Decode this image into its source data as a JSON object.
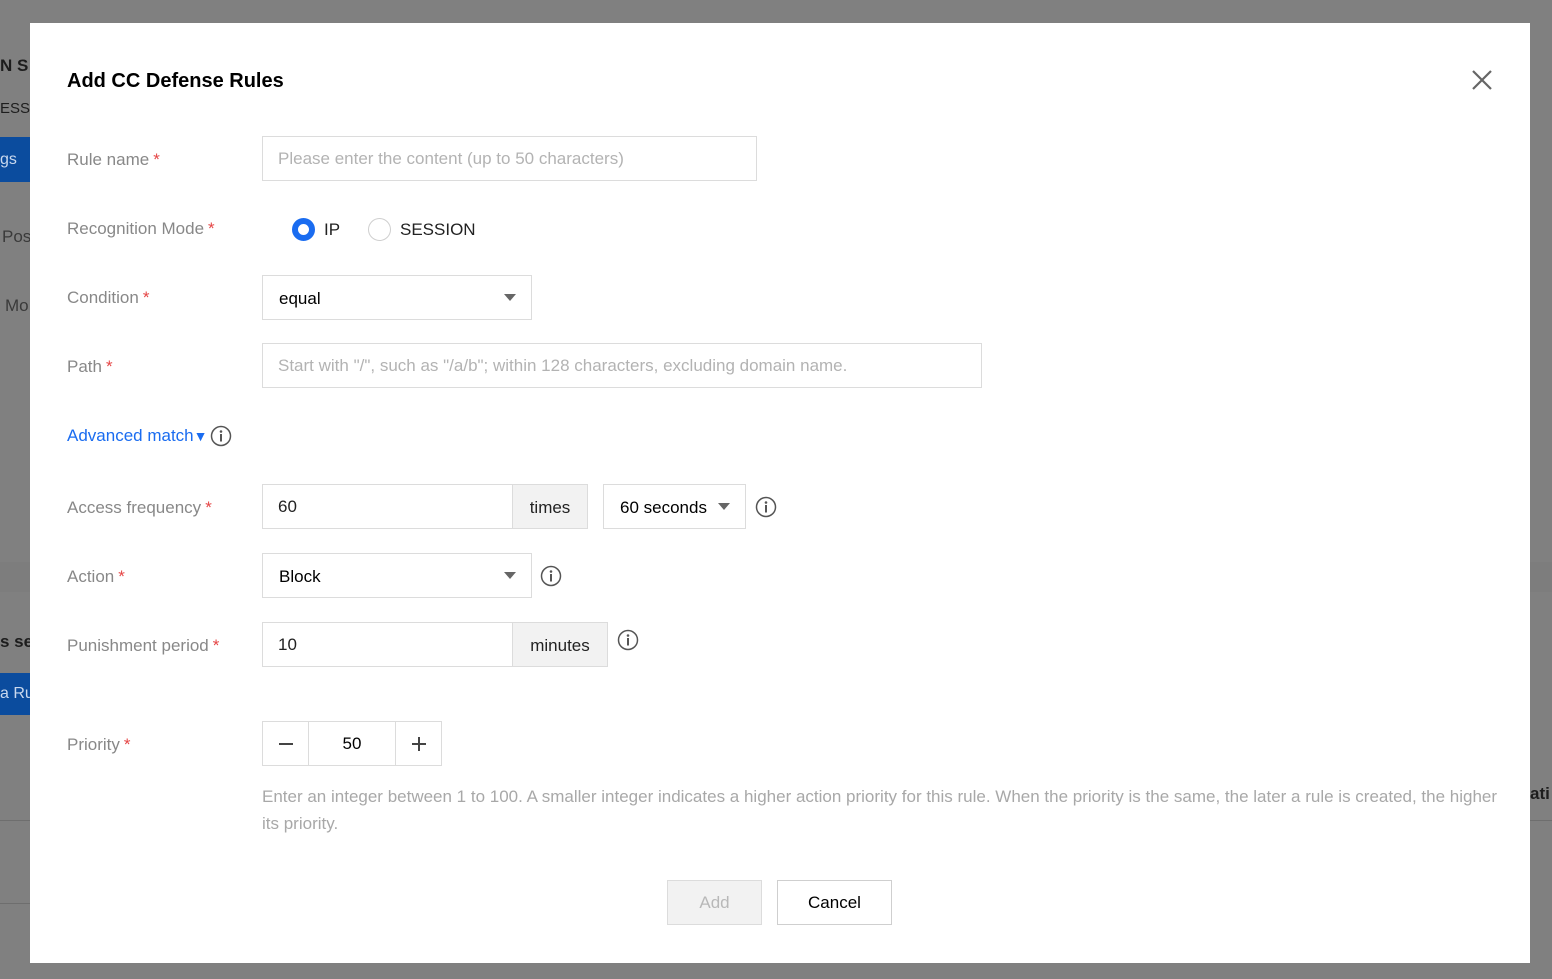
{
  "background": {
    "fragments": [
      "N S",
      "ESSI",
      "gs",
      "Pos",
      "Mo",
      "s se",
      "a Ru",
      "ati"
    ]
  },
  "dialog": {
    "title": "Add CC Defense Rules",
    "close_icon": "close-icon",
    "required_mark": "*",
    "fields": {
      "rule_name": {
        "label": "Rule name",
        "value": "",
        "placeholder": "Please enter the content (up to 50 characters)"
      },
      "recognition_mode": {
        "label": "Recognition Mode",
        "options": [
          "IP",
          "SESSION"
        ],
        "selected": "IP"
      },
      "condition": {
        "label": "Condition",
        "value": "equal"
      },
      "path": {
        "label": "Path",
        "value": "",
        "placeholder": "Start with \"/\", such as \"/a/b\"; within 128 characters, excluding domain name."
      },
      "advanced_match": {
        "label": "Advanced match",
        "arrow": "▼"
      },
      "access_frequency": {
        "label": "Access frequency",
        "value": "60",
        "unit": "times",
        "period": "60 seconds"
      },
      "action": {
        "label": "Action",
        "value": "Block"
      },
      "punishment_period": {
        "label": "Punishment period",
        "value": "10",
        "unit": "minutes"
      },
      "priority": {
        "label": "Priority",
        "value": "50",
        "minus": "−",
        "plus": "+",
        "hint": "Enter an integer between 1 to 100. A smaller integer indicates a higher action priority for this rule. When the priority is the same, the later a rule is created, the higher its priority."
      }
    },
    "buttons": {
      "add": "Add",
      "cancel": "Cancel"
    },
    "colors": {
      "accent": "#1a6cf0",
      "required": "#e54545"
    }
  }
}
